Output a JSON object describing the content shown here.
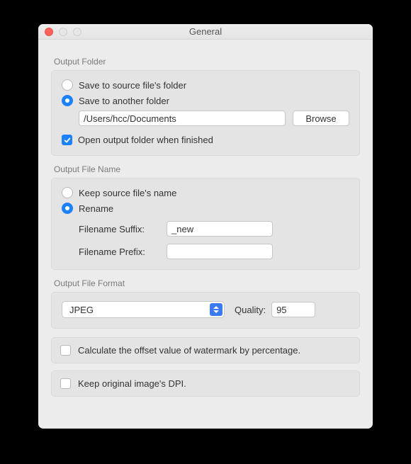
{
  "window": {
    "title": "General"
  },
  "sections": {
    "output_folder": {
      "label": "Output Folder",
      "opt_source": "Save to source file's folder",
      "opt_another": "Save to another folder",
      "selected": "another",
      "path_value": "/Users/hcc/Documents",
      "browse_label": "Browse",
      "open_when_done_label": "Open output folder when finished",
      "open_when_done_checked": true
    },
    "output_name": {
      "label": "Output File Name",
      "opt_keep": "Keep source file's name",
      "opt_rename": "Rename",
      "selected": "rename",
      "suffix_label": "Filename Suffix:",
      "suffix_value": "_new",
      "prefix_label": "Filename Prefix:",
      "prefix_value": ""
    },
    "output_format": {
      "label": "Output File Format",
      "format_value": "JPEG",
      "quality_label": "Quality:",
      "quality_value": "95"
    }
  },
  "options": {
    "offset_percentage": {
      "label": "Calculate the offset value of watermark by percentage.",
      "checked": false
    },
    "keep_dpi": {
      "label": "Keep original image's DPI.",
      "checked": false
    }
  }
}
